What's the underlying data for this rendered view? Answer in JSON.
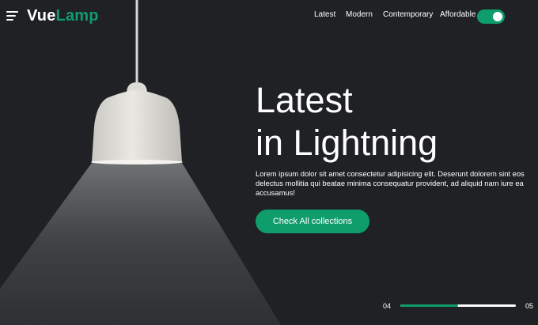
{
  "brand": {
    "part1": "Vue",
    "part2": "Lamp"
  },
  "nav": {
    "links": [
      "Latest",
      "Modern",
      "Contemporary",
      "Affordable"
    ],
    "toggle_on": true
  },
  "hero": {
    "title_line1": "Latest",
    "title_line2": "in Lightning",
    "description": "Lorem ipsum dolor sit amet consectetur adipisicing elit. Deserunt dolorem sint eos delectus mollitia qui beatae minima consequatur provident, ad aliquid nam iure ea accusamus!",
    "cta_label": "Check All collections"
  },
  "slider": {
    "current": "04",
    "next": "05",
    "progress": 0.5
  },
  "colors": {
    "background": "#1f2125",
    "accent": "#0f9d6c",
    "text": "#ffffff"
  },
  "icons": {
    "menu": "hamburger-menu-icon",
    "lamp": "pendant-lamp-illustration"
  }
}
